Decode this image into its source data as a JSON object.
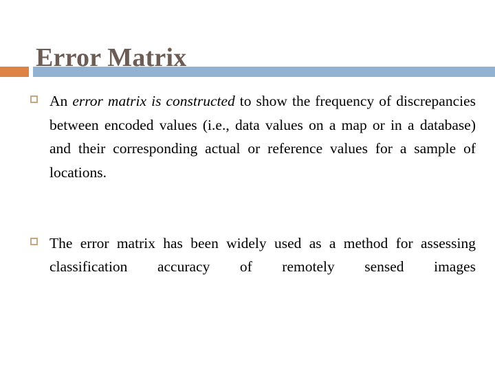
{
  "slide": {
    "title": "Error Matrix",
    "theme": {
      "title_color": "#6b5d55",
      "accent_color": "#dd8346",
      "bar_color": "#91b3d1",
      "bullet_color": "#c9a582",
      "body_color": "#000000",
      "background_color": "#ffffff"
    },
    "bullets": [
      {
        "marker": "hollow-square",
        "segments": [
          {
            "text": "An ",
            "style": "regular"
          },
          {
            "text": "error matrix is constructed",
            "style": "italic"
          },
          {
            "text": " to show the frequency of discrepancies between encoded values (i.e., data values on a map or in a database) and their corresponding actual or reference values for a sample of locations.",
            "style": "regular"
          }
        ],
        "plain_text": "An error matrix is constructed to show the frequency of discrepancies between encoded values (i.e., data values on a map or in a database) and their corresponding actual or reference values for a sample of locations."
      },
      {
        "marker": "hollow-square",
        "segments": [
          {
            "text": "The error matrix has been widely used as a method for assessing classification accuracy of remotely sensed images",
            "style": "regular"
          }
        ],
        "plain_text": "The error matrix has been widely used as a method for assessing classification accuracy of remotely sensed images"
      }
    ]
  }
}
